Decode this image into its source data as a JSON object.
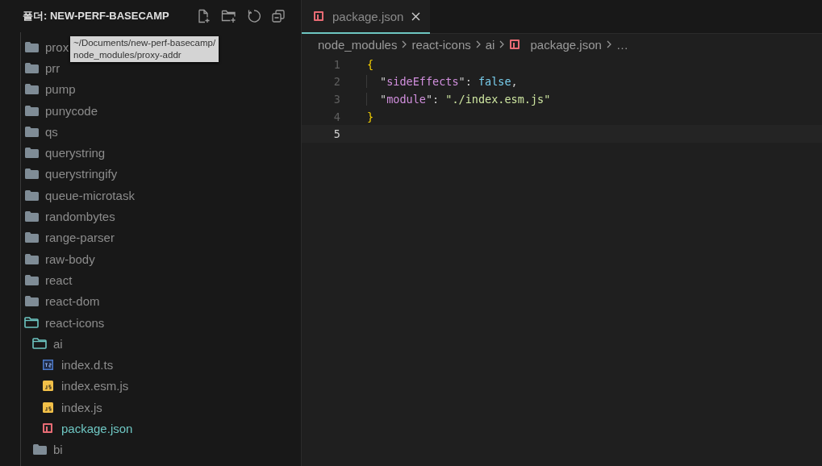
{
  "explorer": {
    "title": "폴더: NEW-PERF-BASECAMP",
    "tree": [
      {
        "name": "prox",
        "kind": "folder",
        "expanded": false,
        "selected": false
      },
      {
        "name": "prr",
        "kind": "folder",
        "expanded": false,
        "selected": false
      },
      {
        "name": "pump",
        "kind": "folder",
        "expanded": false,
        "selected": false
      },
      {
        "name": "punycode",
        "kind": "folder",
        "expanded": false,
        "selected": false
      },
      {
        "name": "qs",
        "kind": "folder",
        "expanded": false,
        "selected": false
      },
      {
        "name": "querystring",
        "kind": "folder",
        "expanded": false,
        "selected": false
      },
      {
        "name": "querystringify",
        "kind": "folder",
        "expanded": false,
        "selected": false
      },
      {
        "name": "queue-microtask",
        "kind": "folder",
        "expanded": false,
        "selected": false
      },
      {
        "name": "randombytes",
        "kind": "folder",
        "expanded": false,
        "selected": false
      },
      {
        "name": "range-parser",
        "kind": "folder",
        "expanded": false,
        "selected": false
      },
      {
        "name": "raw-body",
        "kind": "folder",
        "expanded": false,
        "selected": false
      },
      {
        "name": "react",
        "kind": "folder",
        "expanded": false,
        "selected": false
      },
      {
        "name": "react-dom",
        "kind": "folder",
        "expanded": false,
        "selected": false
      },
      {
        "name": "react-icons",
        "kind": "folder",
        "expanded": true,
        "selected": false,
        "children": [
          {
            "name": "ai",
            "kind": "folder",
            "expanded": true,
            "selected": false,
            "children": [
              {
                "name": "index.d.ts",
                "kind": "ts",
                "selected": false
              },
              {
                "name": "index.esm.js",
                "kind": "js",
                "selected": false
              },
              {
                "name": "index.js",
                "kind": "js",
                "selected": false
              },
              {
                "name": "package.json",
                "kind": "json",
                "selected": true
              }
            ]
          },
          {
            "name": "bi",
            "kind": "folder",
            "expanded": false,
            "selected": false
          }
        ]
      }
    ],
    "tooltip": "~/Documents/new-perf-basecamp/\nnode_modules/proxy-addr"
  },
  "tabs": [
    {
      "label": "package.json",
      "kind": "json",
      "selected": true
    }
  ],
  "breadcrumbs": [
    {
      "label": "node_modules",
      "kind": "folder"
    },
    {
      "label": "react-icons",
      "kind": "folder"
    },
    {
      "label": "ai",
      "kind": "folder"
    },
    {
      "label": "package.json",
      "kind": "json"
    },
    {
      "label": "…",
      "kind": "more"
    }
  ],
  "code": [
    {
      "number": "1",
      "current": false,
      "tokens": [
        {
          "text": "{",
          "kind": "brace"
        }
      ]
    },
    {
      "number": "2",
      "current": false,
      "tokens": [
        {
          "text": "\"",
          "kind": "punct"
        },
        {
          "text": "sideEffects",
          "kind": "key"
        },
        {
          "text": "\": ",
          "kind": "punct"
        },
        {
          "text": "false",
          "kind": "bool"
        },
        {
          "text": ",",
          "kind": "punct"
        }
      ]
    },
    {
      "number": "3",
      "current": false,
      "tokens": [
        {
          "text": "\"",
          "kind": "punct"
        },
        {
          "text": "module",
          "kind": "key"
        },
        {
          "text": "\": ",
          "kind": "punct"
        },
        {
          "text": "\"./index.esm.js\"",
          "kind": "string"
        }
      ]
    },
    {
      "number": "4",
      "current": false,
      "tokens": [
        {
          "text": "}",
          "kind": "brace"
        }
      ]
    },
    {
      "number": "5",
      "current": true
    }
  ]
}
